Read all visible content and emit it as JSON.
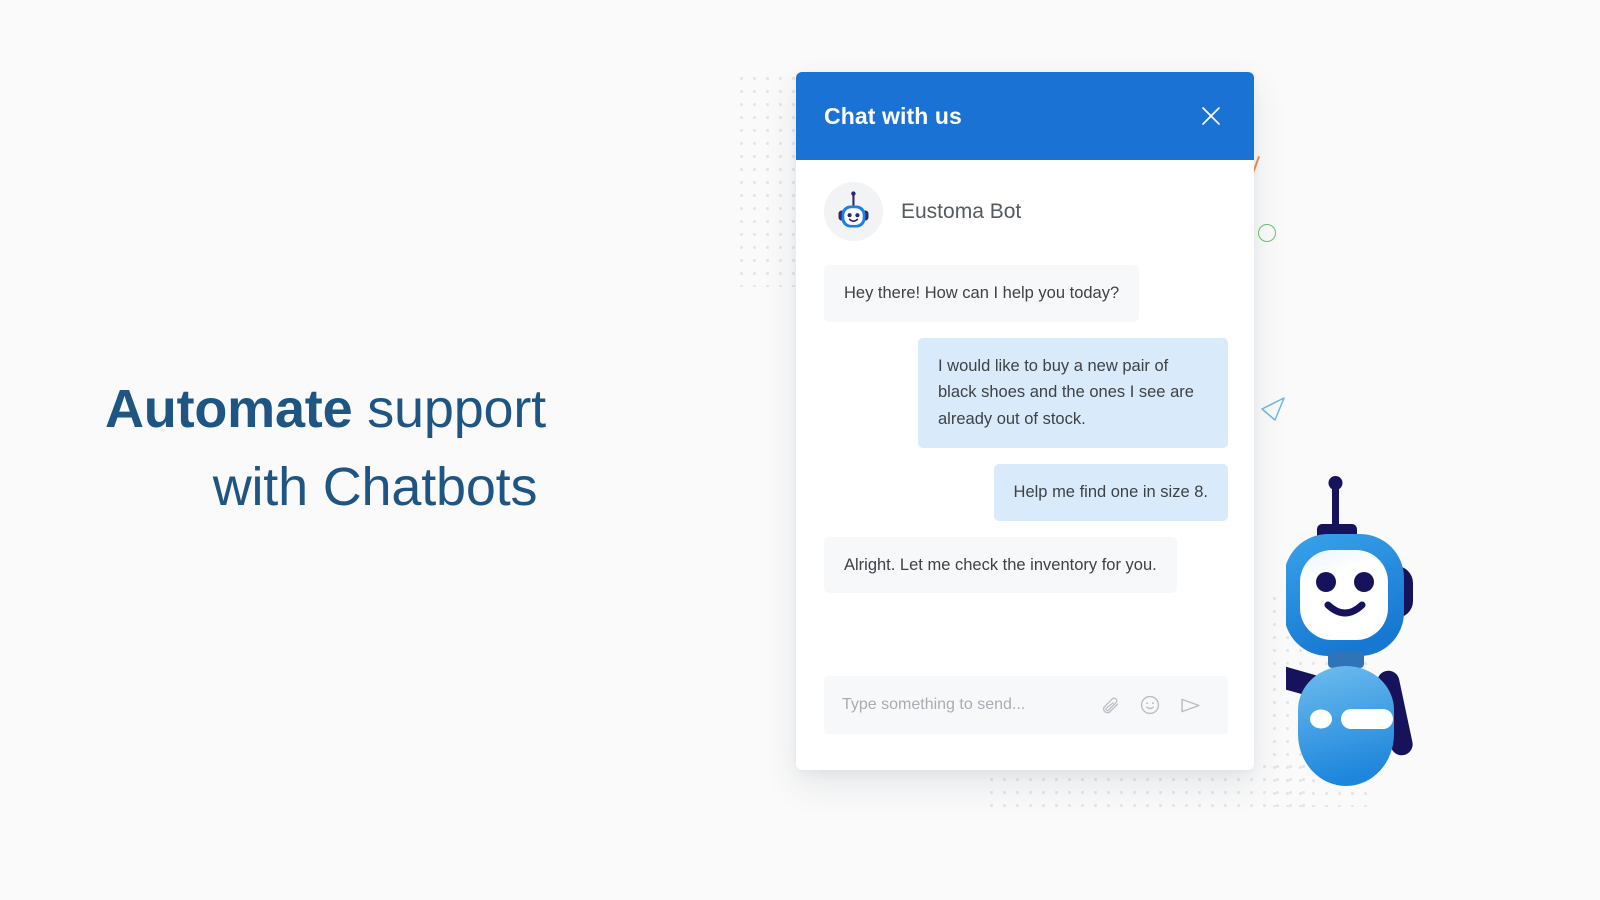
{
  "page": {
    "background_color": "#fafafa",
    "accent_color": "#1a73d4",
    "headline_color": "#1e5582"
  },
  "hero": {
    "headline_bold": "Automate",
    "headline_rest": " support",
    "headline_line2": "with Chatbots"
  },
  "chat_widget": {
    "header": {
      "title": "Chat with us",
      "close_icon": "close-icon",
      "background_color": "#1a73d4",
      "title_color": "#ffffff"
    },
    "bot": {
      "name": "Eustoma Bot",
      "avatar_icon": "robot-avatar-icon"
    },
    "messages": [
      {
        "sender": "bot",
        "text": "Hey there! How can I help you today?"
      },
      {
        "sender": "user",
        "text": "I would like to buy a new pair of black shoes and the ones I see are already out of stock."
      },
      {
        "sender": "user",
        "text": "Help me find one in size 8."
      },
      {
        "sender": "bot",
        "text": "Alright. Let me check the inventory for you."
      }
    ],
    "bubble_colors": {
      "bot": "#f7f8f9",
      "user": "#d9eafb",
      "text": "#3d4246"
    },
    "composer": {
      "placeholder": "Type something to send...",
      "value": "",
      "attach_icon": "paperclip-icon",
      "emoji_icon": "smiley-icon",
      "send_icon": "send-icon"
    }
  },
  "decorations": {
    "dot_grid_color": "#e3e5e7",
    "line_color": "#f0914a",
    "circle_color": "#6cc06c",
    "triangle_color": "#6fb9de",
    "mascot_icon": "robot-mascot-icon"
  }
}
